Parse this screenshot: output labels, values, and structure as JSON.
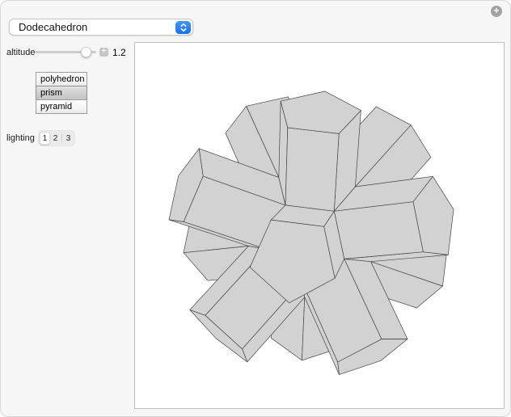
{
  "dropdown": {
    "value": "Dodecahedron"
  },
  "controls": {
    "altitude": {
      "label": "altitude",
      "value": "1.2"
    },
    "shape": {
      "options": [
        "polyhedron",
        "prism",
        "pyramid"
      ],
      "selected": "prism"
    },
    "lighting": {
      "label": "lighting",
      "options": [
        "1",
        "2",
        "3"
      ],
      "selected": "1"
    }
  },
  "scene": {
    "polyhedron": "dodecahedron",
    "augmentation": "prism",
    "face_color": "#d2d2d2",
    "edge_color": "#454545",
    "background": "#ffffff"
  }
}
